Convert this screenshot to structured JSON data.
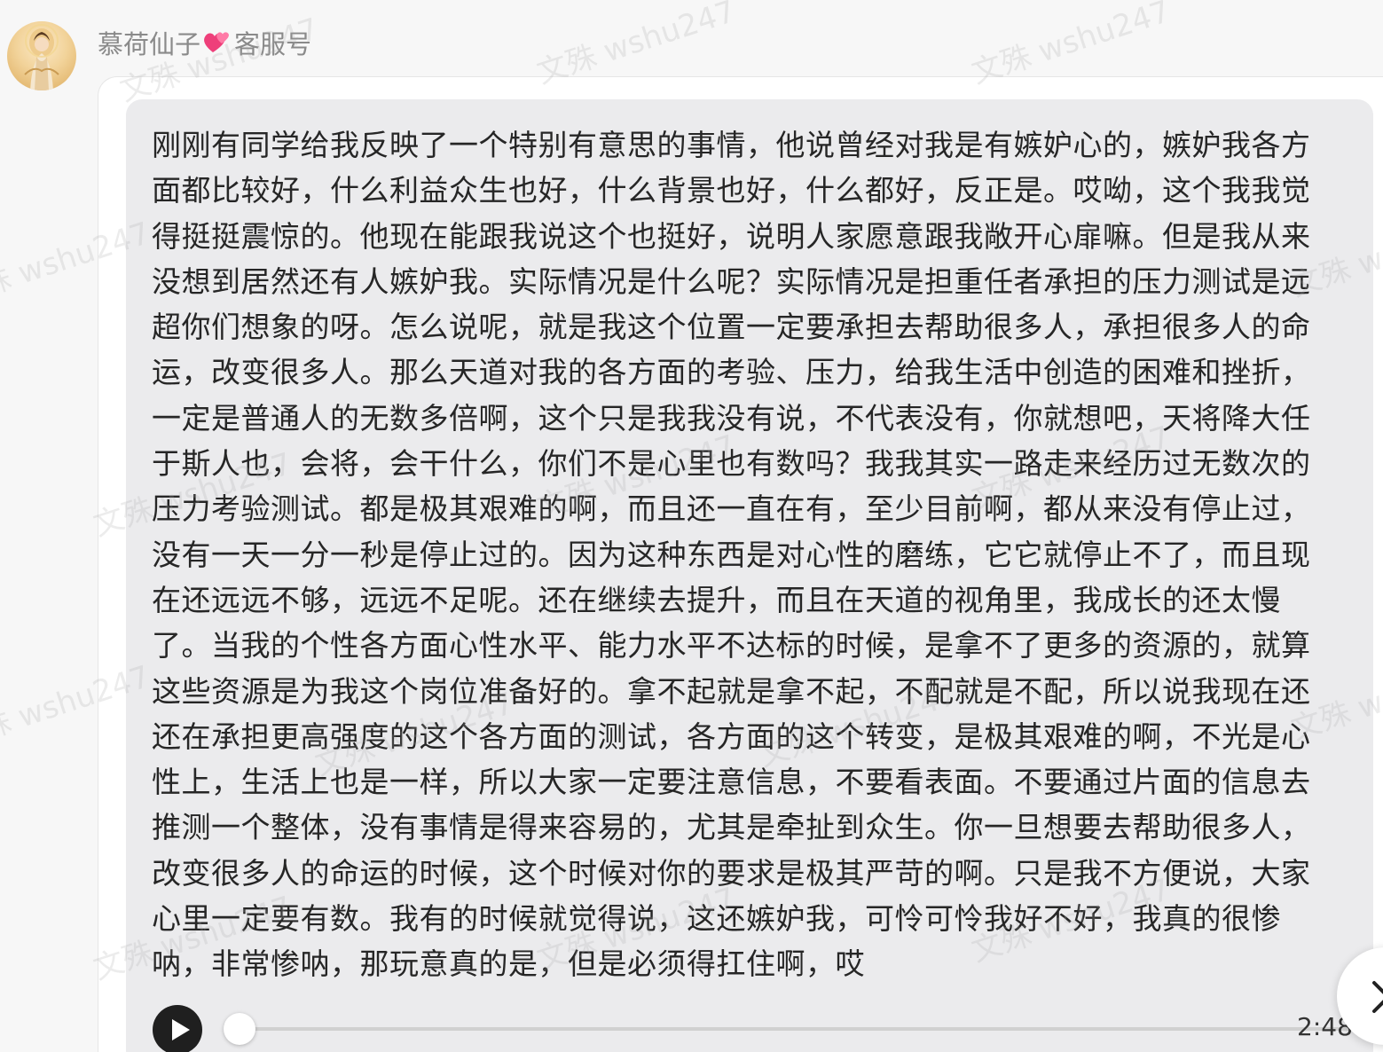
{
  "message": {
    "sender": {
      "name": "慕荷仙子",
      "heart_icon": "two-hearts-icon",
      "tag": "客服号"
    },
    "transcript_lines": [
      "刚刚有同学给我反映了一个特别有意思的事情，他说曾经对我是有嫉妒心的，嫉妒我各方",
      "面都比较好，什么利益众生也好，什么背景也好，什么都好，反正是。哎呦，这个我我觉",
      "得挺挺震惊的。他现在能跟我说这个也挺好，说明人家愿意跟我敞开心扉嘛。但是我从来",
      "没想到居然还有人嫉妒我。实际情况是什么呢？实际情况是担重任者承担的压力测试是远",
      "超你们想象的呀。怎么说呢，就是我这个位置一定要承担去帮助很多人，承担很多人的命",
      "运，改变很多人。那么天道对我的各方面的考验、压力，给我生活中创造的困难和挫折，",
      "一定是普通人的无数多倍啊，这个只是我我没有说，不代表没有，你就想吧，天将降大任",
      "于斯人也，会将，会干什么，你们不是心里也有数吗？我我其实一路走来经历过无数次的",
      "压力考验测试。都是极其艰难的啊，而且还一直在有，至少目前啊，都从来没有停止过，",
      "没有一天一分一秒是停止过的。因为这种东西是对心性的磨练，它它就停止不了，而且现",
      "在还远远不够，远远不足呢。还在继续去提升，而且在天道的视角里，我成长的还太慢",
      "了。当我的个性各方面心性水平、能力水平不达标的时候，是拿不了更多的资源的，就算",
      "这些资源是为我这个岗位准备好的。拿不起就是拿不起，不配就是不配，所以说我现在还",
      "还在承担更高强度的这个各方面的测试，各方面的这个转变，是极其艰难的啊，不光是心",
      "性上，生活上也是一样，所以大家一定要注意信息，不要看表面。不要通过片面的信息去",
      "推测一个整体，没有事情是得来容易的，尤其是牵扯到众生。你一旦想要去帮助很多人，",
      "改变很多人的命运的时候，这个时候对你的要求是极其严苛的啊。只是我不方便说，大家",
      "心里一定要有数。我有的时候就觉得说，这还嫉妒我，可怜可怜我好不好，我真的很惨",
      "呐，非常惨呐，那玩意真的是，但是必须得扛住啊，哎"
    ]
  },
  "audio_player": {
    "play_icon": "play-icon",
    "duration": "2:48",
    "progress_fraction": 0.0
  },
  "watermark": {
    "text": "文殊 wshu247"
  },
  "floating_button": {
    "icon": "chevron-icon"
  },
  "colors": {
    "bubble_background": "#ebebed",
    "text": "#262626",
    "sender_name": "#8a8a8a",
    "play_button": "#1f1f1f"
  }
}
